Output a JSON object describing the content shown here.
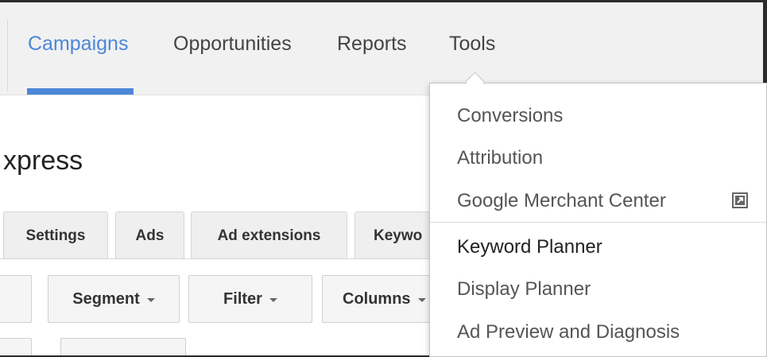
{
  "nav": {
    "tabs": [
      {
        "label": "Campaigns",
        "active": true
      },
      {
        "label": "Opportunities",
        "active": false
      },
      {
        "label": "Reports",
        "active": false
      },
      {
        "label": "Tools",
        "active": false
      }
    ],
    "accent_color": "#4d86d9"
  },
  "campaign": {
    "name_fragment": "xpress"
  },
  "subtabs": [
    "Settings",
    "Ads",
    "Ad extensions",
    "Keywo"
  ],
  "toolbar": {
    "segment_label": "Segment",
    "filter_label": "Filter",
    "columns_label": "Columns"
  },
  "tools_menu": {
    "items": [
      {
        "label": "Conversions",
        "icon": null
      },
      {
        "label": "Attribution",
        "icon": null
      },
      {
        "label": "Google Merchant Center",
        "icon": "external-link-icon"
      },
      {
        "label": "Keyword Planner",
        "icon": null
      },
      {
        "label": "Display Planner",
        "icon": null
      },
      {
        "label": "Ad Preview and Diagnosis",
        "icon": null
      }
    ]
  }
}
